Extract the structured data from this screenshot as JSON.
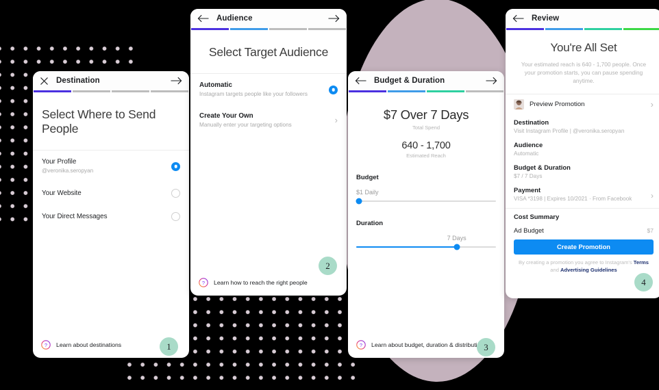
{
  "theme": {
    "background": "#000000",
    "dot_color": "#d9cdd6",
    "circle_color": "#c4b2bd",
    "badge_color": "#a9dbc8",
    "accent_blue": "#0d8bf2",
    "progress_colors": [
      "#4b30e0",
      "#3f9ce8",
      "#2ed0a0",
      "#3bd845"
    ],
    "progress_inactive": "#bdbdbd"
  },
  "screens": [
    {
      "id": "destination",
      "nav": {
        "left_icon": "close-icon",
        "title": "Destination",
        "right_icon": "arrow-right-icon"
      },
      "progress": {
        "total": 4,
        "active": 1
      },
      "heading": "Select Where to Send People",
      "options": [
        {
          "title": "Your Profile",
          "subtitle": "@veronika.seropyan",
          "control": "radio",
          "selected": true
        },
        {
          "title": "Your Website",
          "subtitle": "",
          "control": "radio",
          "selected": false
        },
        {
          "title": "Your Direct Messages",
          "subtitle": "",
          "control": "radio",
          "selected": false
        }
      ],
      "footer": {
        "icon": "help-circle-icon",
        "text": "Learn about destinations"
      },
      "badge": "1"
    },
    {
      "id": "audience",
      "nav": {
        "left_icon": "arrow-left-icon",
        "title": "Audience",
        "right_icon": "arrow-right-icon"
      },
      "progress": {
        "total": 4,
        "active": 2
      },
      "heading": "Select Target Audience",
      "options": [
        {
          "title": "Automatic",
          "subtitle": "Instagram targets people like your followers",
          "control": "radio",
          "selected": true
        },
        {
          "title": "Create Your Own",
          "subtitle": "Manually enter your targeting options",
          "control": "chevron",
          "selected": false
        }
      ],
      "footer": {
        "icon": "help-circle-icon",
        "text": "Learn how to reach the right people"
      },
      "badge": "2"
    },
    {
      "id": "budget",
      "nav": {
        "left_icon": "arrow-left-icon",
        "title": "Budget & Duration",
        "right_icon": "arrow-right-icon"
      },
      "progress": {
        "total": 4,
        "active": 3
      },
      "spend": {
        "amount": "$7 Over 7 Days",
        "label": "Total Spend"
      },
      "reach": {
        "amount": "640 - 1,700",
        "label": "Estimated Reach"
      },
      "budget_slider": {
        "heading": "Budget",
        "value": "$1 Daily",
        "fill_percent": 2,
        "knob_percent": 2
      },
      "duration_slider": {
        "heading": "Duration",
        "value": "7 Days",
        "fill_percent": 72,
        "knob_percent": 72
      },
      "footer": {
        "icon": "help-circle-icon",
        "text": "Learn about budget, duration & distribution"
      },
      "badge": "3"
    },
    {
      "id": "review",
      "nav": {
        "left_icon": "arrow-left-icon",
        "title": "Review",
        "right_icon": ""
      },
      "progress": {
        "total": 4,
        "active": 4
      },
      "heading": "You're All Set",
      "subheading": "Your estimated reach is 640 - 1,700 people. Once your promotion starts, you can pause spending anytime.",
      "preview": {
        "label": "Preview Promotion",
        "thumb": "profile-photo",
        "chevron": "chevron-right-icon"
      },
      "summary": [
        {
          "key": "Destination",
          "value": "Visit Instagram Profile | @veronika.seropyan",
          "chevron": false
        },
        {
          "key": "Audience",
          "value": "Automatic",
          "chevron": false
        },
        {
          "key": "Budget & Duration",
          "value": "$7 / 7 Days",
          "chevron": false
        },
        {
          "key": "Payment",
          "value": "VISA *3198 | Expires 10/2021 · From Facebook",
          "chevron": true
        }
      ],
      "cost_summary": {
        "heading": "Cost Summary",
        "rows": [
          {
            "key": "Ad Budget",
            "value": "$7"
          }
        ]
      },
      "cta_label": "Create Promotion",
      "legal": {
        "prefix": "By creating a promotion you agree to Instagram's ",
        "terms": "Terms",
        "middle": " and ",
        "guidelines": "Advertising Guidelines"
      },
      "badge": "4"
    }
  ]
}
